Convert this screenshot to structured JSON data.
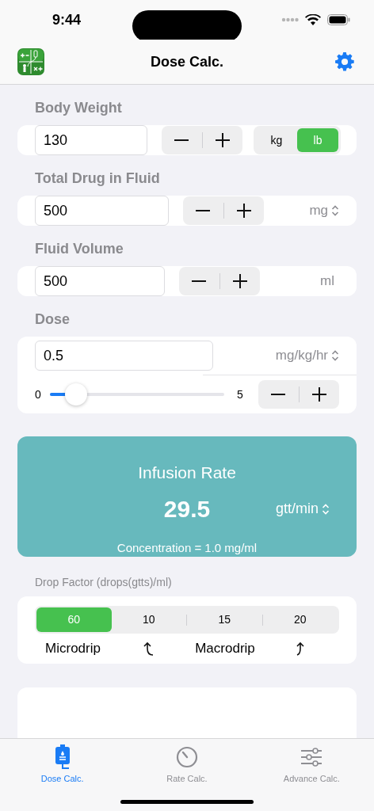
{
  "status_bar": {
    "time": "9:44"
  },
  "nav": {
    "title": "Dose Calc."
  },
  "fields": [
    {
      "kind": "units",
      "label": "Body Weight",
      "value": "130",
      "units": [
        {
          "label": "kg",
          "selected": false
        },
        {
          "label": "lb",
          "selected": true
        }
      ]
    },
    {
      "kind": "picker",
      "label": "Total Drug in Fluid",
      "value": "500",
      "unit": "mg"
    },
    {
      "kind": "plain",
      "label": "Fluid Volume",
      "value": "500",
      "unit": "ml"
    }
  ],
  "dose": {
    "label": "Dose",
    "value": "0.5",
    "unit": "mg/kg/hr",
    "slider": {
      "min": "0",
      "max": "5",
      "level": 0.1
    }
  },
  "result": {
    "title": "Infusion Rate",
    "value": "29.5",
    "unit": "gtt/min",
    "concentration": "Concentration = 1.0 mg/ml"
  },
  "drop_factor": {
    "label": "Drop Factor (drops(gtts)/ml)",
    "options": [
      {
        "label": "60",
        "selected": true
      },
      {
        "label": "10",
        "selected": false
      },
      {
        "label": "15",
        "selected": false
      },
      {
        "label": "20",
        "selected": false
      }
    ],
    "captions": [
      {
        "kind": "text",
        "label": "Microdrip"
      },
      {
        "kind": "arrow-left"
      },
      {
        "kind": "text",
        "label": "Macrodrip"
      },
      {
        "kind": "arrow-right"
      }
    ]
  },
  "tabs": [
    {
      "label": "Dose Calc.",
      "selected": true
    },
    {
      "label": "Rate Calc.",
      "selected": false
    },
    {
      "label": "Advance Calc.",
      "selected": false
    }
  ]
}
